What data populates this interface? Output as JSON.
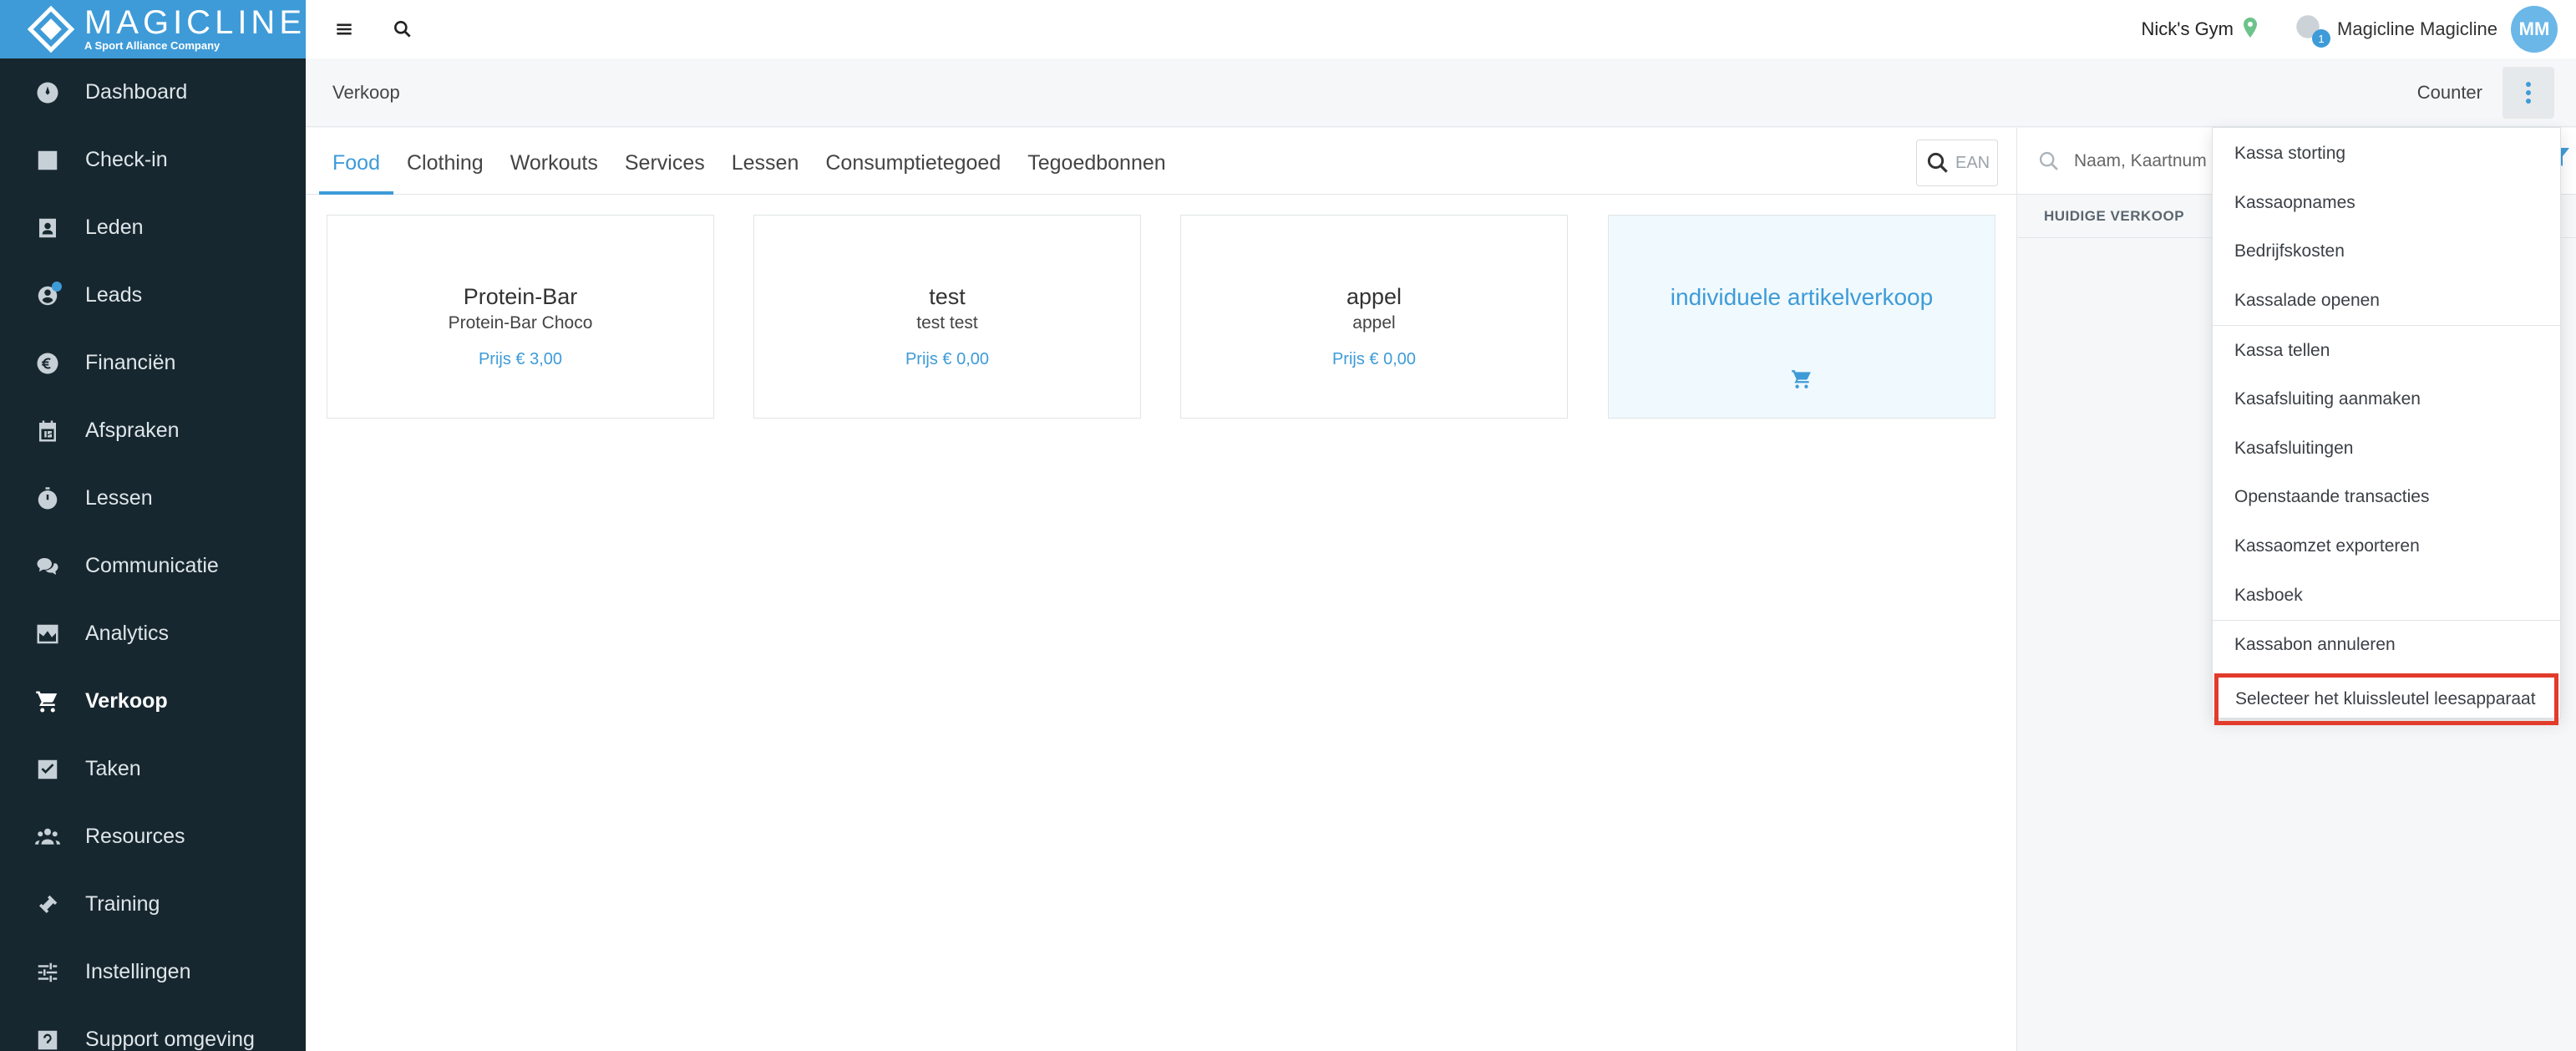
{
  "brand": {
    "name": "MAGICLINE",
    "tagline": "A Sport Alliance Company"
  },
  "sidebar": {
    "items": [
      {
        "label": "Dashboard",
        "icon": "dashboard-icon"
      },
      {
        "label": "Check-in",
        "icon": "check-in-icon"
      },
      {
        "label": "Leden",
        "icon": "members-icon"
      },
      {
        "label": "Leads",
        "icon": "leads-icon"
      },
      {
        "label": "Financiën",
        "icon": "euro-icon"
      },
      {
        "label": "Afspraken",
        "icon": "calendar-icon"
      },
      {
        "label": "Lessen",
        "icon": "stopwatch-icon"
      },
      {
        "label": "Communicatie",
        "icon": "chat-icon"
      },
      {
        "label": "Analytics",
        "icon": "chart-icon"
      },
      {
        "label": "Verkoop",
        "icon": "cart-icon"
      },
      {
        "label": "Taken",
        "icon": "checkbox-icon"
      },
      {
        "label": "Resources",
        "icon": "people-icon"
      },
      {
        "label": "Training",
        "icon": "dumbbell-icon"
      },
      {
        "label": "Instellingen",
        "icon": "sliders-icon"
      },
      {
        "label": "Support omgeving",
        "icon": "support-icon"
      }
    ],
    "active": "Verkoop"
  },
  "topbar": {
    "gym": "Nick's Gym",
    "user_name": "Magicline Magicline",
    "avatar_initials": "MM",
    "notification_count": "1"
  },
  "page": {
    "title": "Verkoop",
    "counter_label": "Counter"
  },
  "tabs": [
    "Food",
    "Clothing",
    "Workouts",
    "Services",
    "Lessen",
    "Consumptietegoed",
    "Tegoedbonnen"
  ],
  "ean_placeholder": "EAN",
  "products": [
    {
      "title": "Protein-Bar",
      "subtitle": "Protein-Bar Choco",
      "price": "Prijs € 3,00"
    },
    {
      "title": "test",
      "subtitle": "test test",
      "price": "Prijs € 0,00"
    },
    {
      "title": "appel",
      "subtitle": "appel",
      "price": "Prijs € 0,00"
    }
  ],
  "individual_sale": "individuele artikelverkoop",
  "right_panel": {
    "search_placeholder": "Naam, Kaartnum",
    "current_sale_header": "HUIDIGE VERKOOP"
  },
  "menu": {
    "group1": [
      "Kassa storting",
      "Kassaopnames",
      "Bedrijfskosten",
      "Kassalade openen"
    ],
    "group2": [
      "Kassa tellen",
      "Kasafsluiting aanmaken",
      "Kasafsluitingen",
      "Openstaande transacties",
      "Kassaomzet exporteren",
      "Kasboek"
    ],
    "group3": [
      "Kassabon annuleren",
      "Selecteer het kluissleutel leesapparaat"
    ]
  },
  "colors": {
    "accent": "#3e9bd8",
    "sidebar": "#17272f",
    "highlight": "#e23b2b"
  }
}
